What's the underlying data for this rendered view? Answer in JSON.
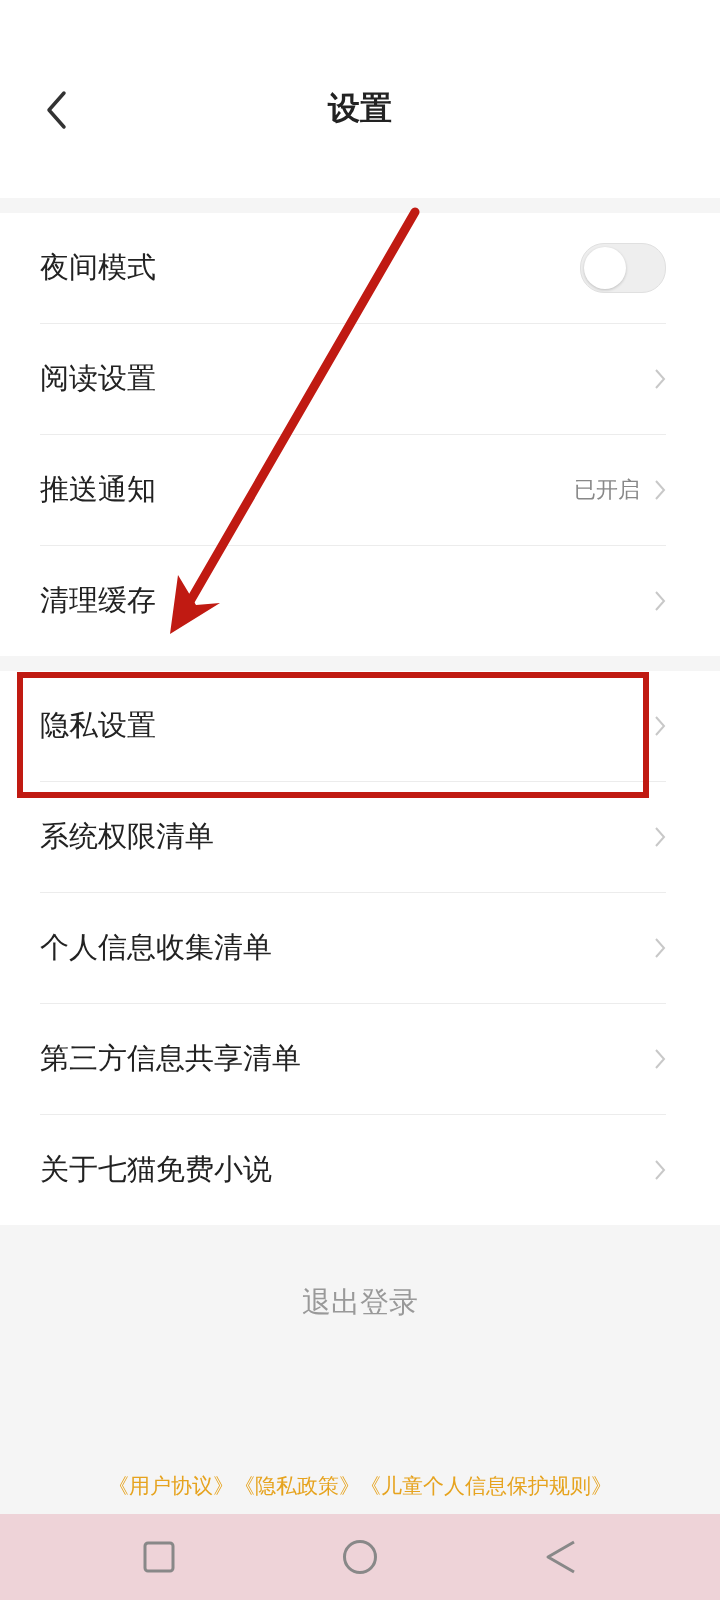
{
  "header": {
    "title": "设置"
  },
  "sections": [
    {
      "items": [
        {
          "label": "夜间模式",
          "kind": "toggle",
          "on": false
        },
        {
          "label": "阅读设置",
          "kind": "link"
        },
        {
          "label": "推送通知",
          "kind": "link",
          "value": "已开启"
        },
        {
          "label": "清理缓存",
          "kind": "link"
        }
      ]
    },
    {
      "items": [
        {
          "label": "隐私设置",
          "kind": "link"
        },
        {
          "label": "系统权限清单",
          "kind": "link"
        },
        {
          "label": "个人信息收集清单",
          "kind": "link"
        },
        {
          "label": "第三方信息共享清单",
          "kind": "link"
        },
        {
          "label": "关于七猫免费小说",
          "kind": "link"
        }
      ]
    }
  ],
  "logout": "退出登录",
  "links": [
    "《用户协议》",
    "《隐私政策》",
    "《儿童个人信息保护规则》"
  ]
}
